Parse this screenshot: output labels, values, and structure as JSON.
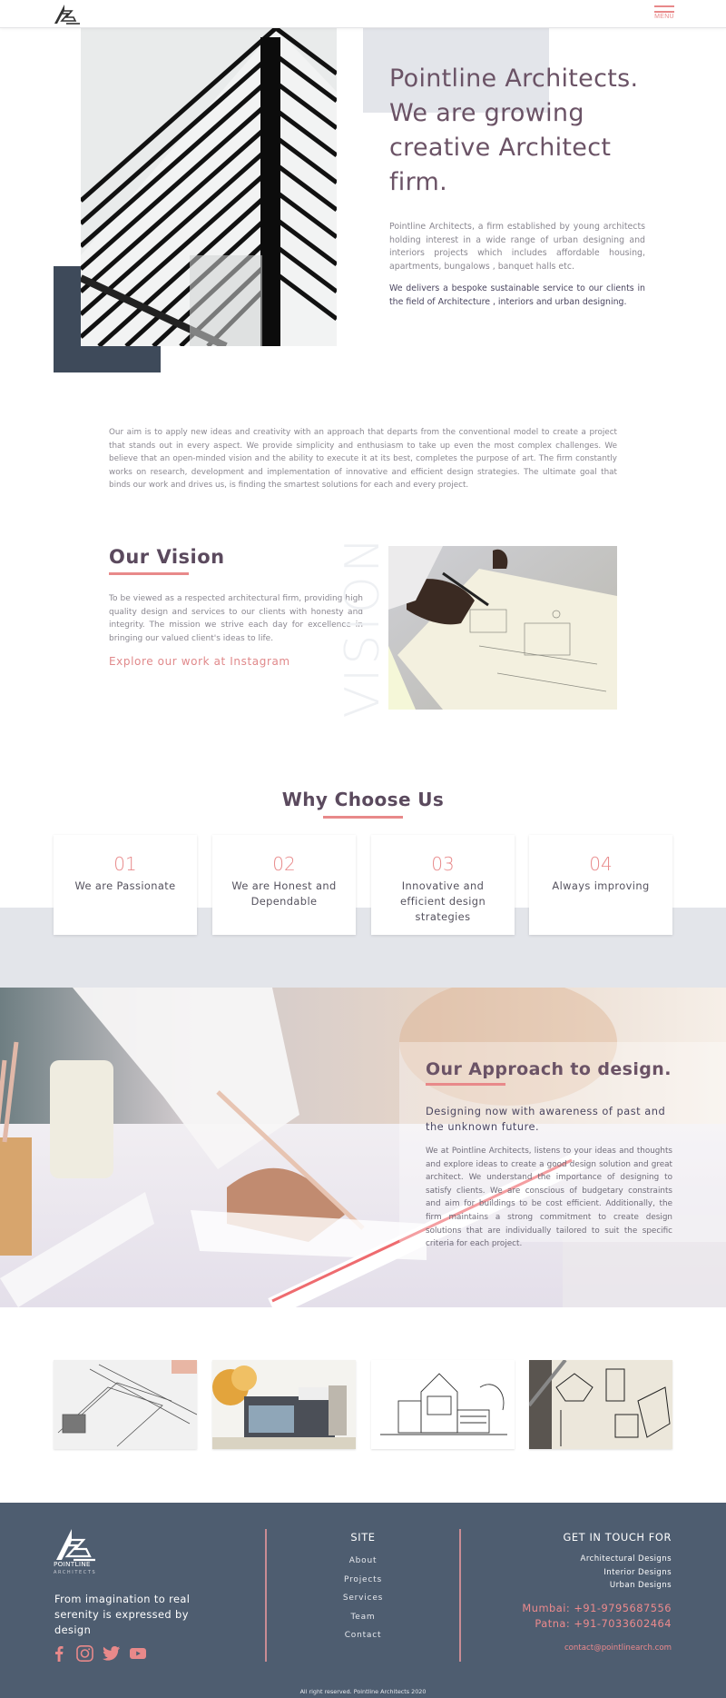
{
  "header": {
    "logo_icon": "pointline-triangle-logo",
    "menu_label": "MENU",
    "menu_icon": "hamburger-icon"
  },
  "hero": {
    "title": "Pointline Architects. We are growing creative Architect firm.",
    "description": "Pointline Architects, a firm established by young architects holding interest in a wide range of urban designing and interiors projects which includes affordable housing, apartments, bungalows , banquet halls etc.",
    "statement": "We delivers a bespoke sustainable service to our clients in the field of Architecture , interiors and urban designing.",
    "image": "building-steel-lattice-photo"
  },
  "aim": {
    "text": "Our aim is to apply new ideas and creativity with an approach that departs from the conventional model to create a project that stands out in every aspect. We provide simplicity and enthusiasm to take up even the most complex challenges. We believe that an open-minded vision and the ability to execute it at its best, completes the purpose of art. The firm constantly works on research, development and implementation of innovative and efficient design strategies. The ultimate goal that binds our work and drives us, is finding the smartest solutions for each and every project."
  },
  "vision": {
    "title": "Our Vision",
    "text": "To be viewed as a respected architectural firm, providing high quality design and services to our clients with honesty and integrity. The mission we strive each day for excellence in bringing our valued client's ideas to life.",
    "link_label": "Explore our work at Instagram",
    "watermark": "VISION",
    "image": "hand-drawing-blueprint-photo"
  },
  "why": {
    "title": "Why Choose Us",
    "cards": [
      {
        "number": "01",
        "label": "We are Passionate"
      },
      {
        "number": "02",
        "label": "We are Honest and Dependable"
      },
      {
        "number": "03",
        "label": "Innovative and efficient design strategies"
      },
      {
        "number": "04",
        "label": "Always improving"
      }
    ]
  },
  "approach": {
    "title": "Our Approach to design.",
    "subtitle": "Designing now with awareness of past and the unknown future.",
    "text": "We at  Pointline Architects, listens to your ideas and thoughts and explore ideas to create a good design solution and great architect. We understand the importance of designing to satisfy clients. We are conscious of budgetary constraints and aim for buildings to be cost efficient. Additionally, the firm maintains a strong commitment to create design solutions that are individually tailored to suit the specific criteria for each project.",
    "image": "hand-sketching-with-pencil-photo"
  },
  "gallery": [
    {
      "image": "pencil-sketch-detail"
    },
    {
      "image": "watercolor-house-sketch"
    },
    {
      "image": "house-line-drawing"
    },
    {
      "image": "sketchbook-architecture-drawings"
    }
  ],
  "footer": {
    "logo_name": "POINTLINE",
    "logo_sub": "ARCHITECTS",
    "tagline": "From imagination to real serenity is expressed by design",
    "social": [
      {
        "icon": "facebook-icon"
      },
      {
        "icon": "instagram-icon"
      },
      {
        "icon": "twitter-icon"
      },
      {
        "icon": "youtube-icon"
      }
    ],
    "site_title": "SITE",
    "site_links": [
      "About",
      "Projects",
      "Services",
      "Team",
      "Contact"
    ],
    "contact_title": "GET IN TOUCH FOR",
    "services": [
      "Architectural Designs",
      "Interior Designs",
      "Urban Designs"
    ],
    "phones": [
      "Mumbai: +91-9795687556",
      "Patna: +91-7033602464"
    ],
    "email": "contact@pointlinearch.com",
    "copyright": "All right reserved.  Pointline Architects 2020"
  },
  "colors": {
    "accent": "#e8898a",
    "heading": "#6b5366",
    "dark_block": "#3e4a5a",
    "footer_bg": "#4e5d70",
    "light_band": "#e3e5ea"
  }
}
